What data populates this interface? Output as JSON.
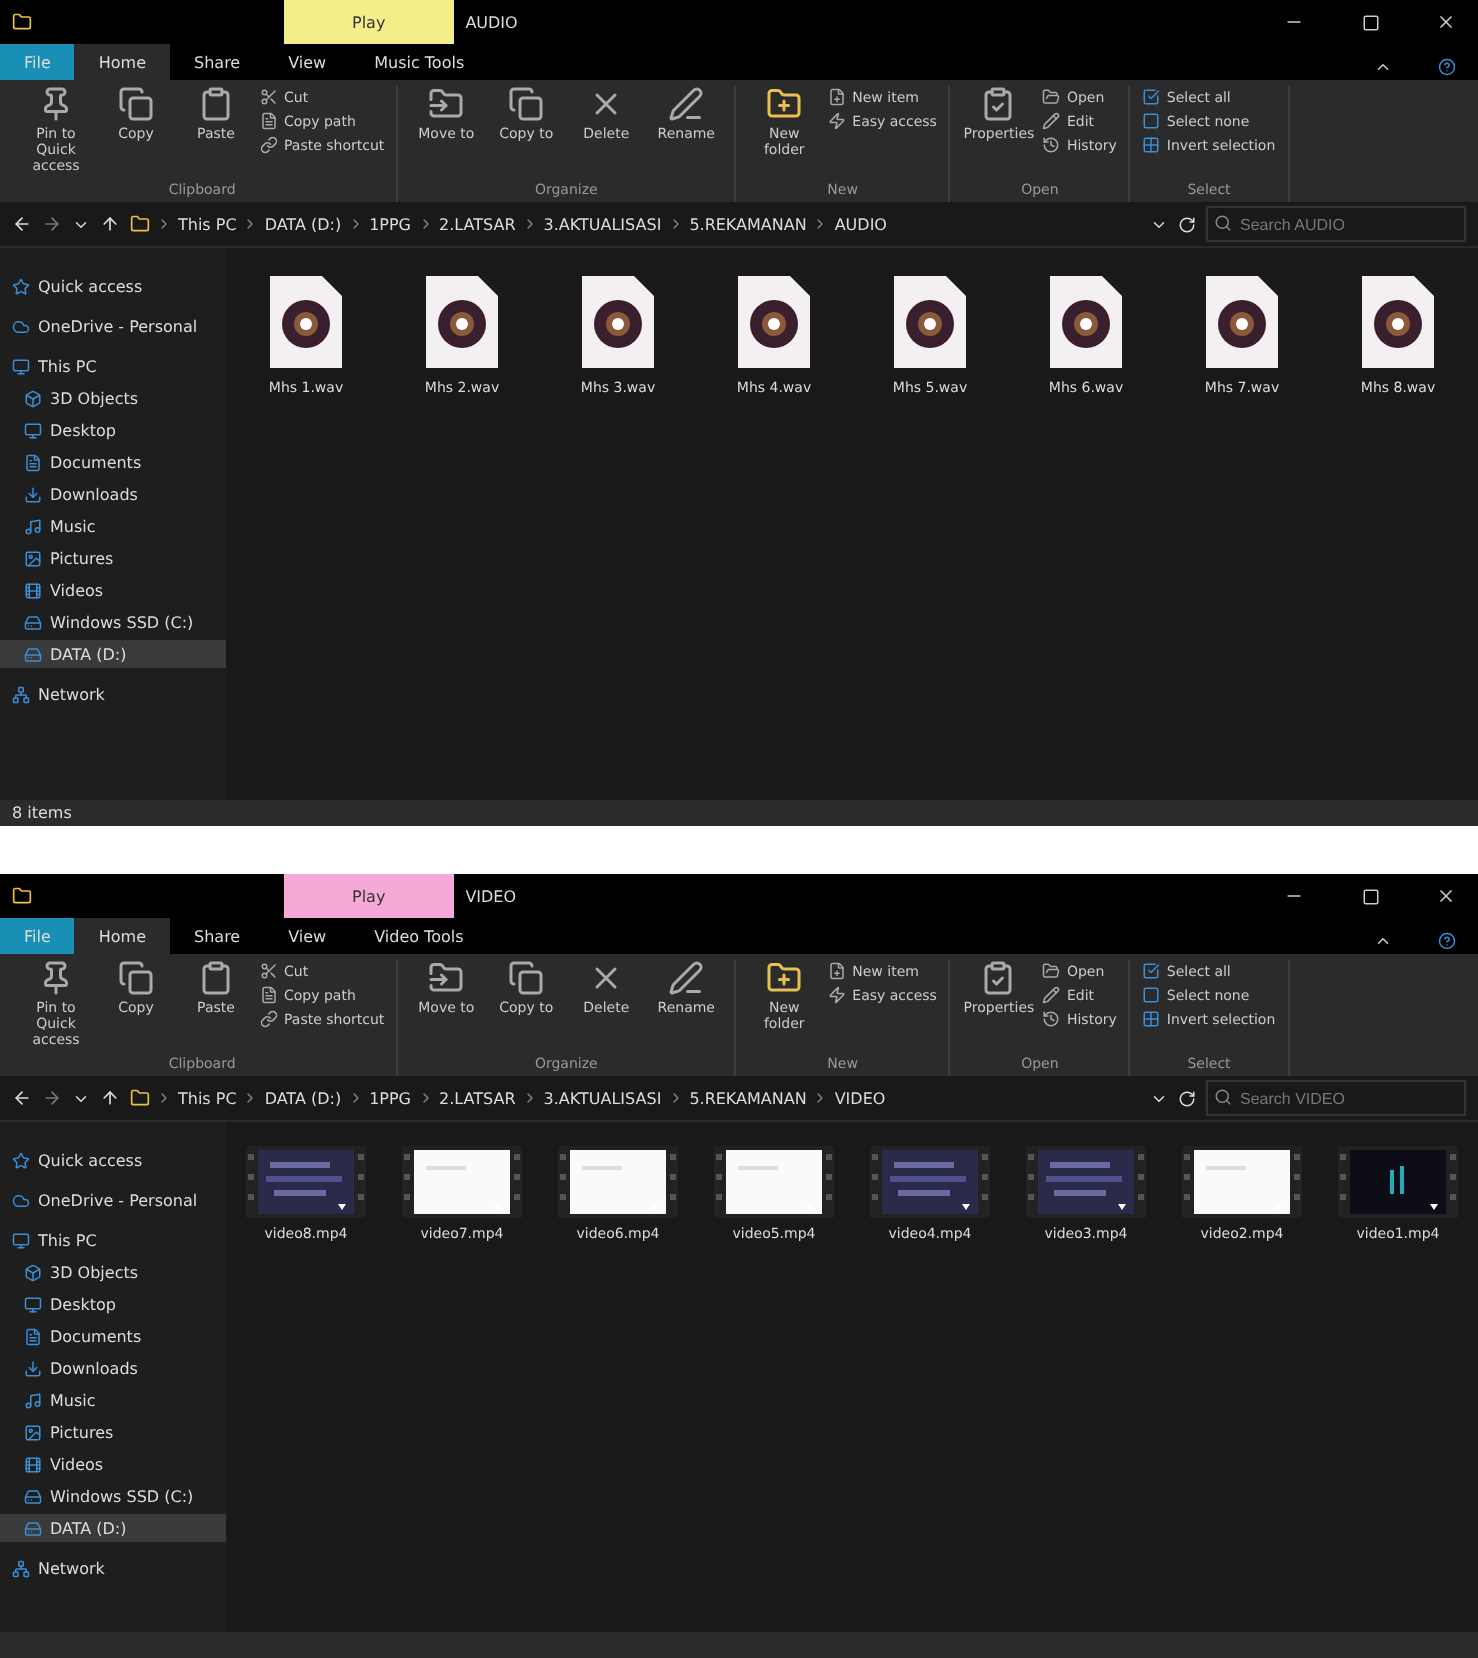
{
  "windows": [
    {
      "title": "AUDIO",
      "context_tab": "Play",
      "color": "#f3ee8a",
      "tabs": [
        {
          "label": "File",
          "selected": false
        },
        {
          "label": "Home",
          "selected": true
        },
        {
          "label": "Share",
          "selected": false
        },
        {
          "label": "View",
          "selected": false
        },
        {
          "label": "Music Tools",
          "selected": false
        }
      ],
      "ribbon": [
        {
          "label": "Clipboard",
          "large": [
            "Pin to Quick access",
            "Copy",
            "Paste"
          ],
          "small": [
            "Cut",
            "Copy path",
            "Paste shortcut"
          ]
        },
        {
          "label": "Organize",
          "large": [
            "Move to",
            "Copy to",
            "Delete",
            "Rename"
          ]
        },
        {
          "label": "New",
          "large": [
            "New folder"
          ],
          "small": [
            "New item",
            "Easy access"
          ]
        },
        {
          "label": "Open",
          "large": [
            "Properties"
          ],
          "small": [
            "Open",
            "Edit",
            "History"
          ]
        },
        {
          "label": "Select",
          "small": [
            "Select all",
            "Select none",
            "Invert selection"
          ]
        }
      ],
      "path": [
        "This PC",
        "DATA (D:)",
        "1PPG",
        "2.LATSAR",
        "3.AKTUALISASI",
        "5.REKAMANAN",
        "AUDIO"
      ],
      "search": {
        "placeholder": "Search AUDIO"
      },
      "sidebar": [
        {
          "label": "Quick access",
          "selected": false
        },
        {
          "label": "OneDrive - Personal",
          "selected": false
        },
        {
          "label": "This PC",
          "selected": false,
          "children": [
            {
              "label": "3D Objects",
              "selected": false
            },
            {
              "label": "Desktop",
              "selected": false
            },
            {
              "label": "Documents",
              "selected": false
            },
            {
              "label": "Downloads",
              "selected": false
            },
            {
              "label": "Music",
              "selected": false
            },
            {
              "label": "Pictures",
              "selected": false
            },
            {
              "label": "Videos",
              "selected": false
            },
            {
              "label": "Windows SSD (C:)",
              "selected": false
            },
            {
              "label": "DATA (D:)",
              "selected": true
            }
          ]
        },
        {
          "label": "Network",
          "selected": false
        }
      ],
      "files": [
        {
          "kind": "audio",
          "name": "Mhs 1.wav"
        },
        {
          "kind": "audio",
          "name": "Mhs 2.wav"
        },
        {
          "kind": "audio",
          "name": "Mhs 3.wav"
        },
        {
          "kind": "audio",
          "name": "Mhs 4.wav"
        },
        {
          "kind": "audio",
          "name": "Mhs 5.wav"
        },
        {
          "kind": "audio",
          "name": "Mhs 6.wav"
        },
        {
          "kind": "audio",
          "name": "Mhs 7.wav"
        },
        {
          "kind": "audio",
          "name": "Mhs 8.wav"
        }
      ],
      "status": "8 items"
    },
    {
      "title": "VIDEO",
      "context_tab": "Play",
      "color": "#f5a9d6",
      "tabs": [
        {
          "label": "File",
          "selected": false
        },
        {
          "label": "Home",
          "selected": true
        },
        {
          "label": "Share",
          "selected": false
        },
        {
          "label": "View",
          "selected": false
        },
        {
          "label": "Video Tools",
          "selected": false
        }
      ],
      "ribbon": [
        {
          "label": "Clipboard",
          "large": [
            "Pin to Quick access",
            "Copy",
            "Paste"
          ],
          "small": [
            "Cut",
            "Copy path",
            "Paste shortcut"
          ]
        },
        {
          "label": "Organize",
          "large": [
            "Move to",
            "Copy to",
            "Delete",
            "Rename"
          ]
        },
        {
          "label": "New",
          "large": [
            "New folder"
          ],
          "small": [
            "New item",
            "Easy access"
          ]
        },
        {
          "label": "Open",
          "large": [
            "Properties"
          ],
          "small": [
            "Open",
            "Edit",
            "History"
          ]
        },
        {
          "label": "Select",
          "small": [
            "Select all",
            "Select none",
            "Invert selection"
          ]
        }
      ],
      "path": [
        "This PC",
        "DATA (D:)",
        "1PPG",
        "2.LATSAR",
        "3.AKTUALISASI",
        "5.REKAMANAN",
        "VIDEO"
      ],
      "search": {
        "placeholder": "Search VIDEO"
      },
      "sidebar": [
        {
          "label": "Quick access",
          "selected": false
        },
        {
          "label": "OneDrive - Personal",
          "selected": false
        },
        {
          "label": "This PC",
          "selected": false,
          "children": [
            {
              "label": "3D Objects",
              "selected": false
            },
            {
              "label": "Desktop",
              "selected": false
            },
            {
              "label": "Documents",
              "selected": false
            },
            {
              "label": "Downloads",
              "selected": false
            },
            {
              "label": "Music",
              "selected": false
            },
            {
              "label": "Pictures",
              "selected": false
            },
            {
              "label": "Videos",
              "selected": false
            },
            {
              "label": "Windows SSD (C:)",
              "selected": false
            },
            {
              "label": "DATA (D:)",
              "selected": true
            }
          ]
        },
        {
          "label": "Network",
          "selected": false
        }
      ],
      "files": [
        {
          "kind": "video",
          "name": "video8.mp4"
        },
        {
          "kind": "video",
          "name": "video7.mp4"
        },
        {
          "kind": "video",
          "name": "video6.mp4"
        },
        {
          "kind": "video",
          "name": "video5.mp4"
        },
        {
          "kind": "video",
          "name": "video4.mp4"
        },
        {
          "kind": "video",
          "name": "video3.mp4"
        },
        {
          "kind": "video",
          "name": "video2.mp4"
        },
        {
          "kind": "video",
          "name": "video1.mp4"
        }
      ]
    }
  ]
}
